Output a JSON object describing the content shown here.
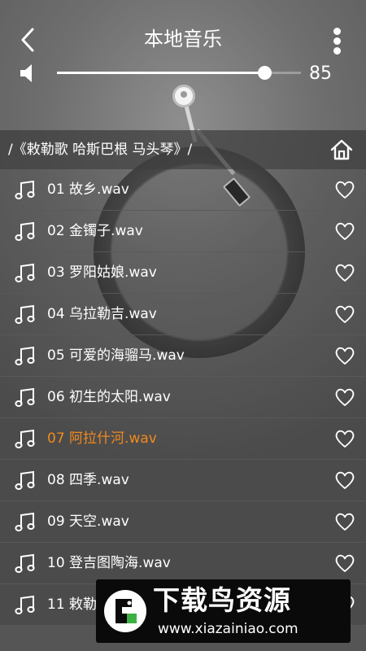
{
  "header": {
    "title": "本地音乐"
  },
  "volume": {
    "value": "85",
    "level": 0.85
  },
  "breadcrumb": {
    "path": "/《敕勒歌 哈斯巴根 马头琴》/"
  },
  "tracks": [
    {
      "name": "01 故乡.wav",
      "active": false
    },
    {
      "name": "02 金镯子.wav",
      "active": false
    },
    {
      "name": "03 罗阳姑娘.wav",
      "active": false
    },
    {
      "name": "04 乌拉勒吉.wav",
      "active": false
    },
    {
      "name": "05 可爱的海骝马.wav",
      "active": false
    },
    {
      "name": "06 初生的太阳.wav",
      "active": false
    },
    {
      "name": "07 阿拉什河.wav",
      "active": true
    },
    {
      "name": "08 四季.wav",
      "active": false
    },
    {
      "name": "09 天空.wav",
      "active": false
    },
    {
      "name": "10 登吉图陶海.wav",
      "active": false
    },
    {
      "name": "11 敕勒歌.wav",
      "active": false
    }
  ],
  "colors": {
    "active_track": "#f08a1e",
    "text": "#ffffff"
  },
  "watermark": {
    "title": "下载鸟资源",
    "url": "www.xiazainiao.com"
  }
}
